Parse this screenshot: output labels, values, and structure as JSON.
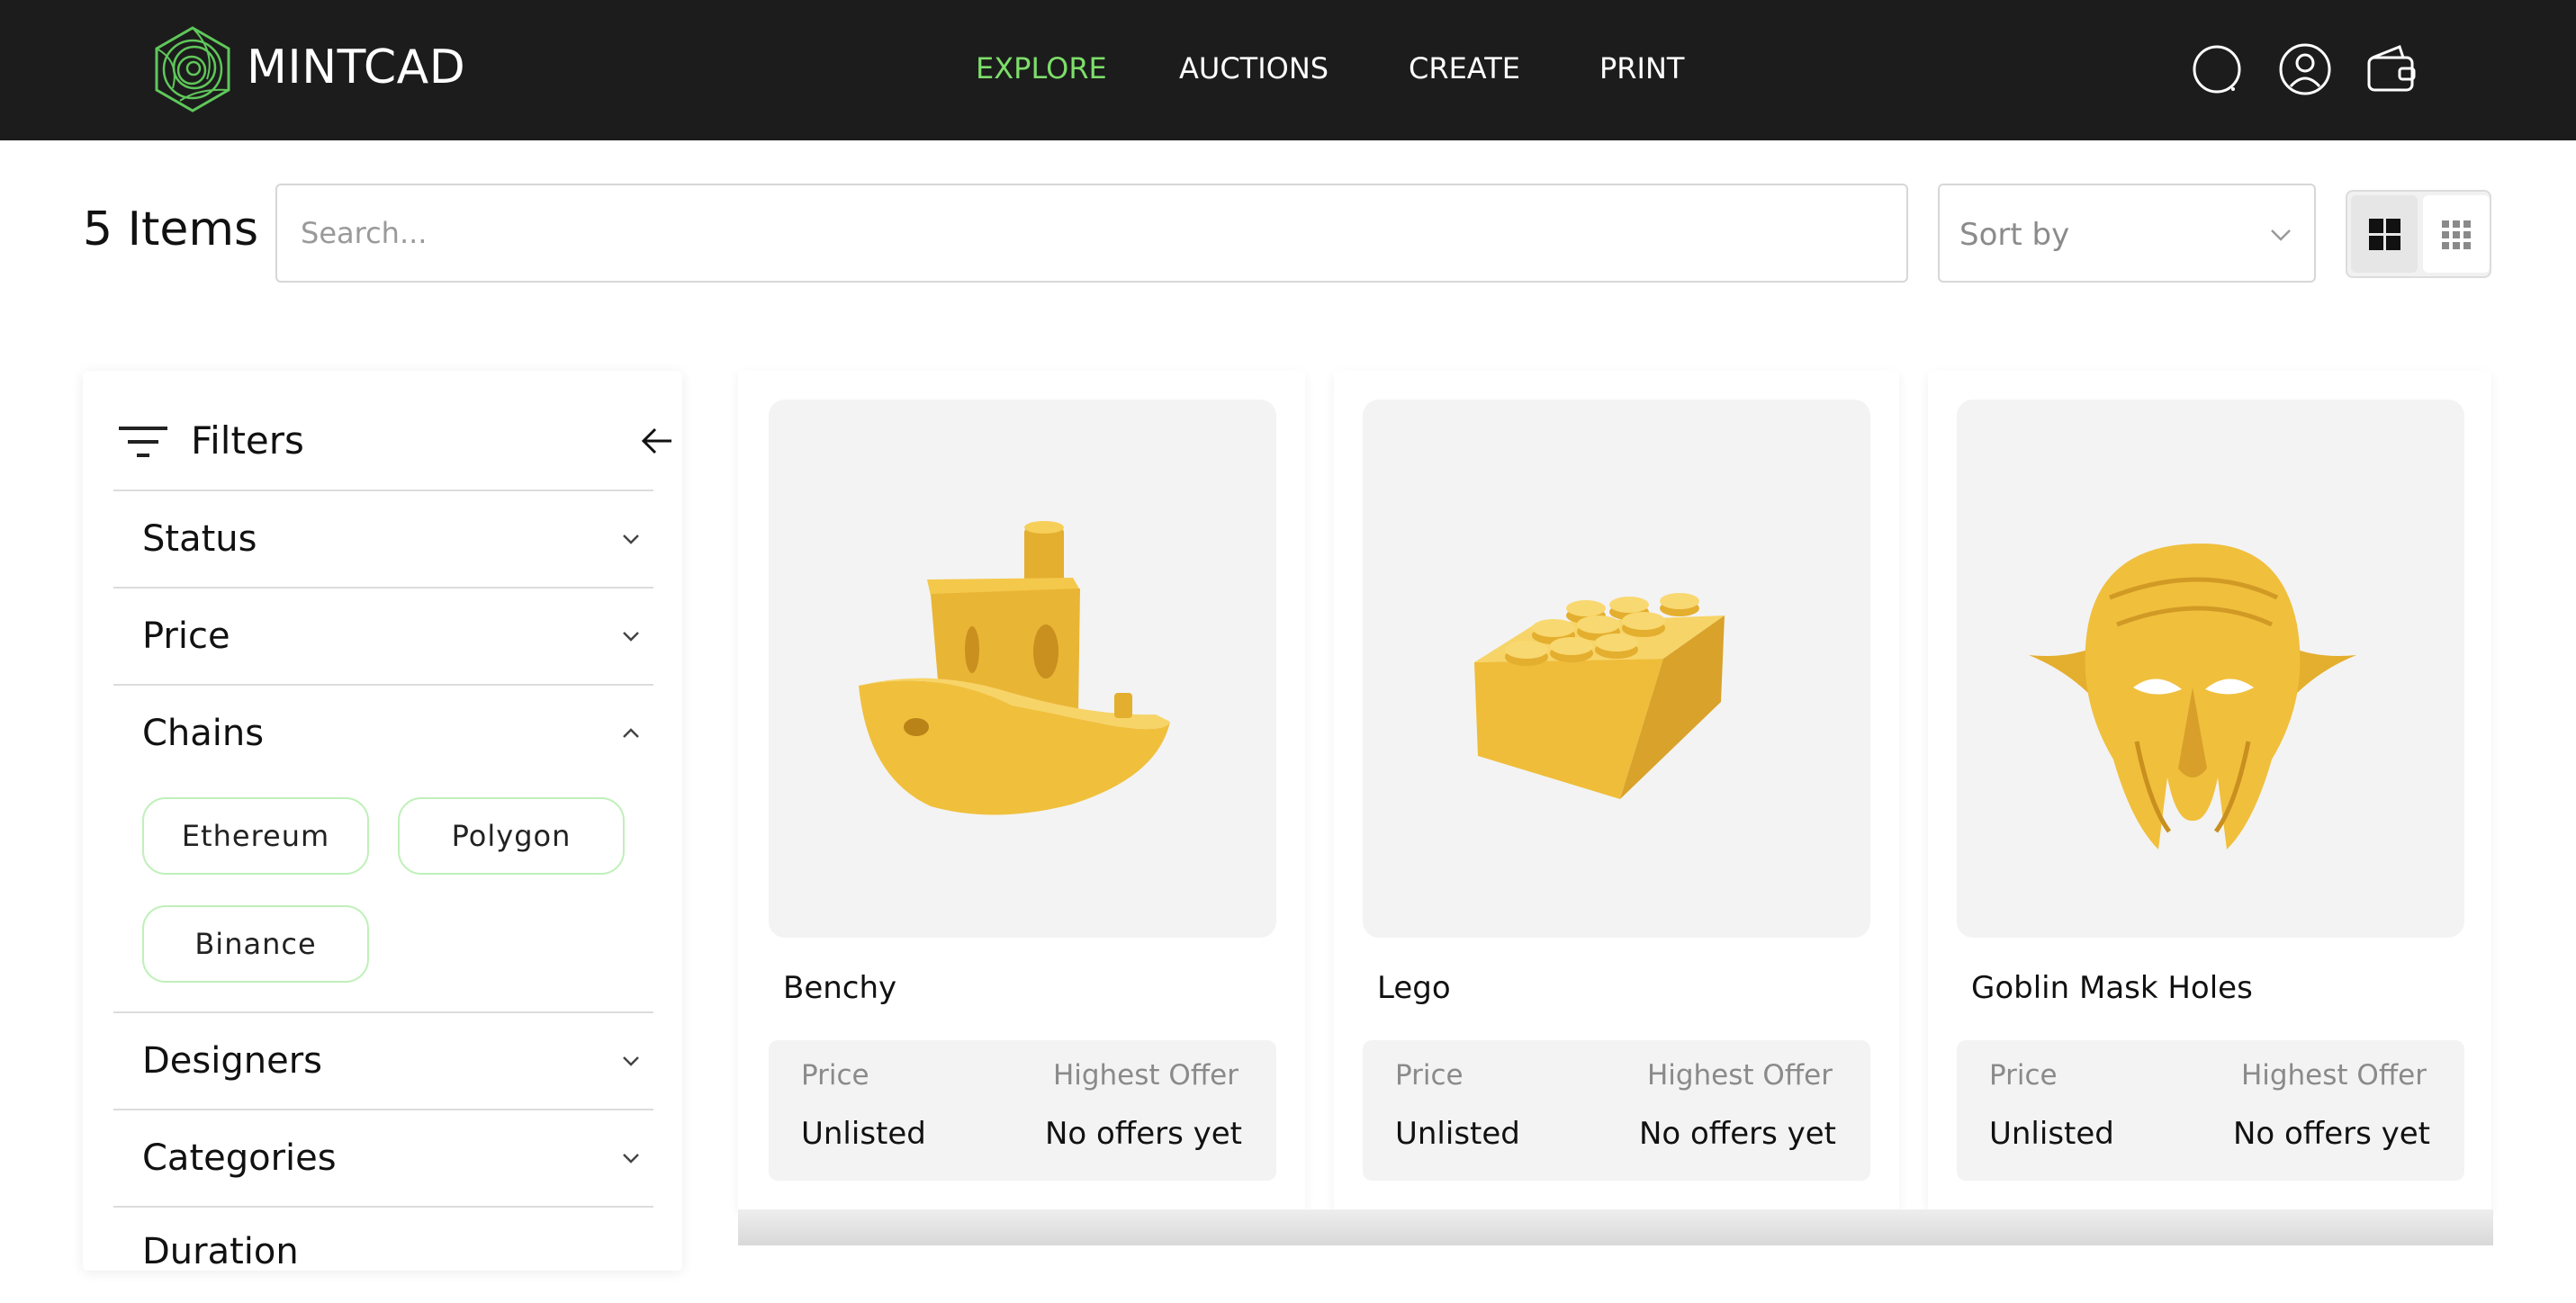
{
  "app": {
    "brand": "MINTCAD"
  },
  "nav": {
    "links": [
      {
        "label": "EXPLORE",
        "active": true
      },
      {
        "label": "AUCTIONS",
        "active": false
      },
      {
        "label": "CREATE",
        "active": false
      },
      {
        "label": "PRINT",
        "active": false
      }
    ],
    "icons": [
      "search-icon",
      "user-icon",
      "wallet-icon"
    ]
  },
  "toolbar": {
    "items_count": "5 Items",
    "search_placeholder": "Search...",
    "sort_label": "Sort by",
    "view_modes": [
      "large-grid",
      "small-grid"
    ],
    "active_view": "large-grid"
  },
  "filters": {
    "title": "Filters",
    "sections": [
      {
        "label": "Status",
        "expanded": false
      },
      {
        "label": "Price",
        "expanded": false
      },
      {
        "label": "Chains",
        "expanded": true,
        "options": [
          "Ethereum",
          "Polygon",
          "Binance"
        ]
      },
      {
        "label": "Designers",
        "expanded": false
      },
      {
        "label": "Categories",
        "expanded": false
      },
      {
        "label": "Duration",
        "expanded": false
      }
    ]
  },
  "cards": [
    {
      "name": "Benchy",
      "price_label": "Price",
      "price_value": "Unlisted",
      "offer_label": "Highest Offer",
      "offer_value": "No offers yet"
    },
    {
      "name": "Lego",
      "price_label": "Price",
      "price_value": "Unlisted",
      "offer_label": "Highest Offer",
      "offer_value": "No offers yet"
    },
    {
      "name": "Goblin Mask Holes",
      "price_label": "Price",
      "price_value": "Unlisted",
      "offer_label": "Highest Offer",
      "offer_value": "No offers yet"
    }
  ],
  "colors": {
    "accent": "#7dde6a",
    "nav_bg": "#1c1c1c",
    "model_gold": "#f0bf3c",
    "card_bg": "#f3f3f3"
  }
}
